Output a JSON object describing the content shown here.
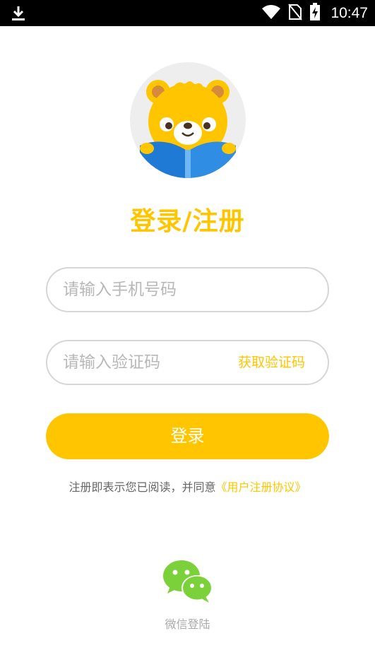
{
  "status_bar": {
    "time": "10:47",
    "icons": [
      "download-icon",
      "wifi-icon",
      "no-sim-icon",
      "battery-charging-icon"
    ]
  },
  "logo": {
    "icon": "bear-reading-book-icon"
  },
  "page_title": "登录/注册",
  "form": {
    "phone_placeholder": "请输入手机号码",
    "phone_value": "",
    "code_placeholder": "请输入验证码",
    "code_value": "",
    "get_code_label": "获取验证码",
    "login_label": "登录"
  },
  "agreement": {
    "text": "注册即表示您已阅读，并同意",
    "link": "《用户注册协议》"
  },
  "wechat": {
    "icon": "wechat-icon",
    "label": "微信登陆"
  },
  "colors": {
    "accent": "#ffc600",
    "status_bar": "#000000",
    "wechat": "#7bd13a",
    "border": "#d6d6d6"
  }
}
